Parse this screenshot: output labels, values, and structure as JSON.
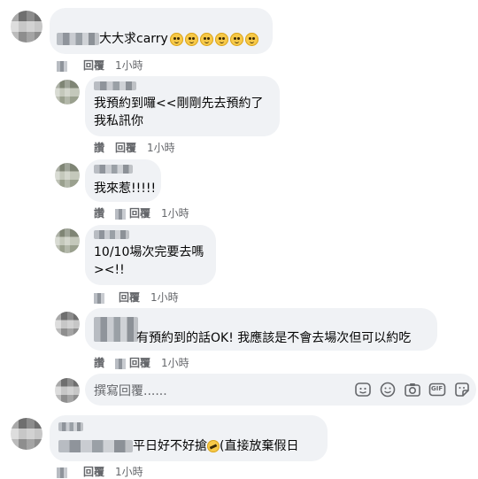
{
  "comments": [
    {
      "id": "c1",
      "text": "大大求carry",
      "emoji_count": 6,
      "reply_label": "回覆",
      "time": "1小時"
    },
    {
      "id": "r1",
      "line1": "我預約到囉<<剛剛先去預約了",
      "line2": "我私訊你",
      "like_label": "讚",
      "reply_label": "回覆",
      "time": "1小時"
    },
    {
      "id": "r2",
      "text": "我來惹!!!!!",
      "like_label": "讚",
      "reply_label": "回覆",
      "time": "1小時"
    },
    {
      "id": "r3",
      "line1": "10/10場次完要去嗎",
      "line2": "><!!",
      "reply_label": "回覆",
      "time": "1小時"
    },
    {
      "id": "r4",
      "text": "有預約到的話OK! 我應該是不會去場次但可以約吃",
      "like_label": "讚",
      "reply_label": "回覆",
      "time": "1小時"
    },
    {
      "id": "c2",
      "text": "平日好不好搶",
      "suffix": "(直接放棄假日",
      "reply_label": "回覆",
      "time": "1小時"
    }
  ],
  "composer": {
    "placeholder": "撰寫回覆......",
    "tools": [
      "sticker-emoji-icon",
      "smile-icon",
      "camera-icon",
      "gif-icon",
      "sticker-icon"
    ],
    "gif_label": "GIF"
  },
  "colors": {
    "bubble": "#f0f2f5",
    "meta": "#65676b",
    "text": "#050505"
  }
}
